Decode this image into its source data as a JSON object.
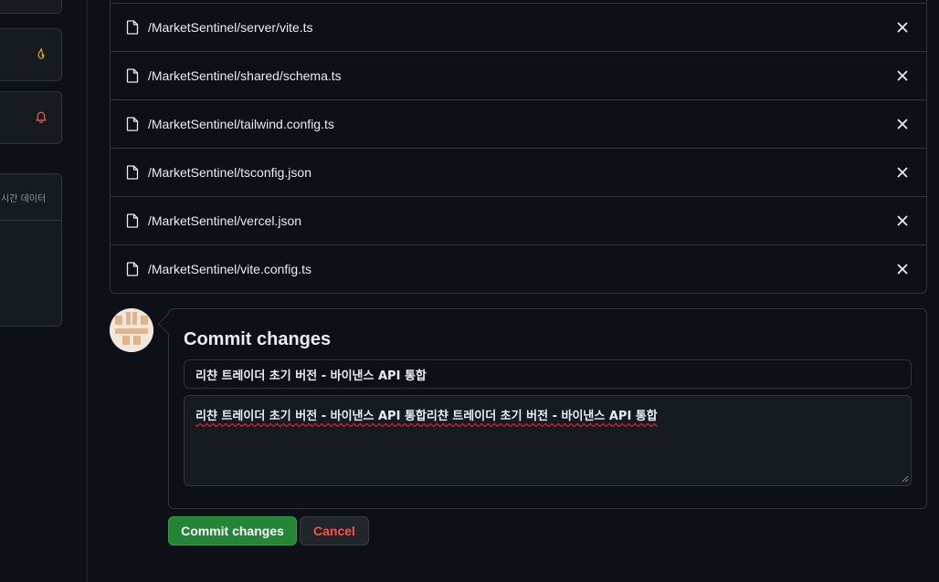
{
  "sidebar": {
    "cards": [
      {
        "icon": ""
      },
      {
        "icon": "flame-icon"
      },
      {
        "icon": "bell-icon"
      },
      {
        "label": "시간 데이터"
      }
    ]
  },
  "files": [
    {
      "path": "/MarketSentinel/server/vite.ts"
    },
    {
      "path": "/MarketSentinel/shared/schema.ts"
    },
    {
      "path": "/MarketSentinel/tailwind.config.ts"
    },
    {
      "path": "/MarketSentinel/tsconfig.json"
    },
    {
      "path": "/MarketSentinel/vercel.json"
    },
    {
      "path": "/MarketSentinel/vite.config.ts"
    }
  ],
  "commit": {
    "title": "Commit changes",
    "summary_value": "리챤 트레이더 초기 버전 - 바이낸스 API 통합",
    "description_value": "리챤 트레이더 초기 버전 - 바이낸스 API 통합리챤 트레이더 초기 버전 - 바이낸스 API 통합",
    "commit_button_label": "Commit changes",
    "cancel_button_label": "Cancel"
  },
  "colors": {
    "background": "#0d1117",
    "border": "#30363d",
    "primary_button": "#238636",
    "danger_text": "#f85149",
    "flame_icon": "#d29922",
    "bell_icon": "#f85149"
  }
}
